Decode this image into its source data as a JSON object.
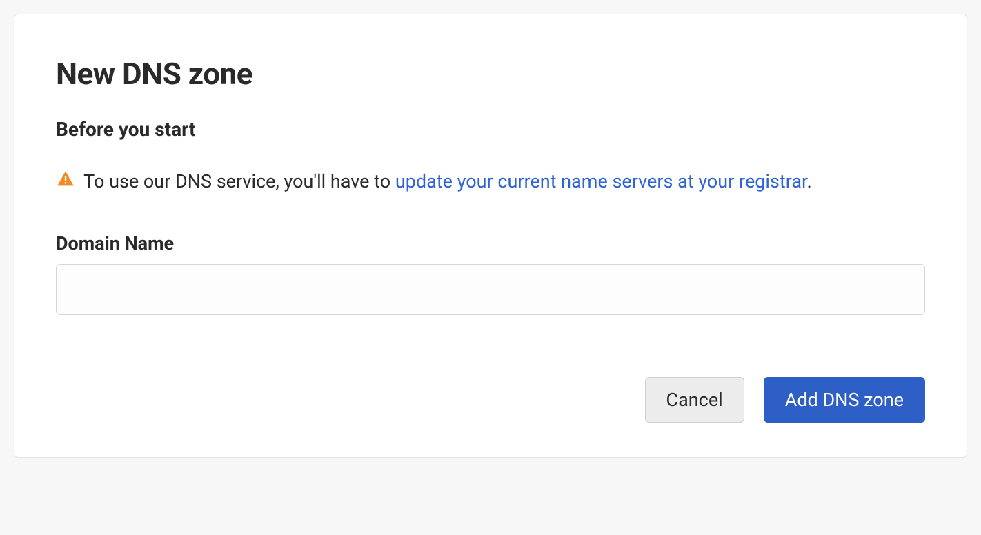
{
  "page": {
    "title": "New DNS zone",
    "subheading": "Before you start",
    "notice_prefix": " To use our DNS service, you'll have to ",
    "notice_link": "update your current name servers at your registrar",
    "notice_suffix": "."
  },
  "form": {
    "domain_label": "Domain Name",
    "domain_value": ""
  },
  "actions": {
    "cancel": "Cancel",
    "submit": "Add DNS zone"
  }
}
